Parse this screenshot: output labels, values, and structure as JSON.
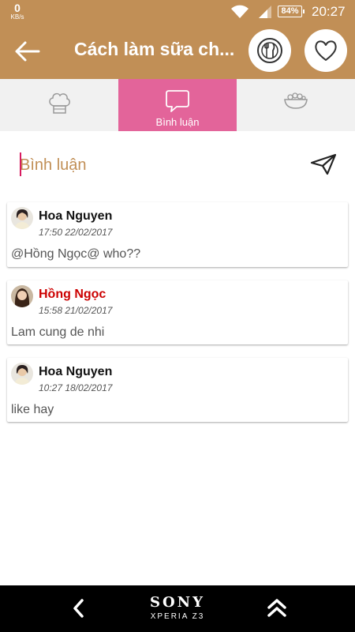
{
  "status_bar": {
    "speed_value": "0",
    "speed_unit": "KB/s",
    "battery": "84%",
    "time": "20:27"
  },
  "app_bar": {
    "title": "Cách làm sữa ch...",
    "icons": [
      "back-arrow-icon",
      "plate-fork-knife-icon",
      "heart-icon"
    ]
  },
  "tabs": [
    {
      "label": "",
      "icon": "chef-hat-icon",
      "active": false
    },
    {
      "label": "Bình luận",
      "icon": "speech-bubble-icon",
      "active": true
    },
    {
      "label": "",
      "icon": "salad-bowl-icon",
      "active": false
    }
  ],
  "comment_input": {
    "placeholder": "Bình luận",
    "send_icon": "send-icon"
  },
  "comments": [
    {
      "user": "Hoa Nguyen",
      "time": "17:50 22/02/2017",
      "text": "@Hồng Ngọc@ who??",
      "name_color": "#111111"
    },
    {
      "user": "Hồng Ngọc",
      "time": "15:58 21/02/2017",
      "text": "Lam cung de nhi",
      "name_color": "#cc0000"
    },
    {
      "user": "Hoa Nguyen",
      "time": "10:27 18/02/2017",
      "text": "like hay",
      "name_color": "#111111"
    }
  ],
  "nav_bar": {
    "brand": "SONY",
    "model": "XPERIA Z3"
  },
  "colors": {
    "header": "#c18f56",
    "active_tab": "#e3649a",
    "highlight_name": "#cc0000"
  }
}
